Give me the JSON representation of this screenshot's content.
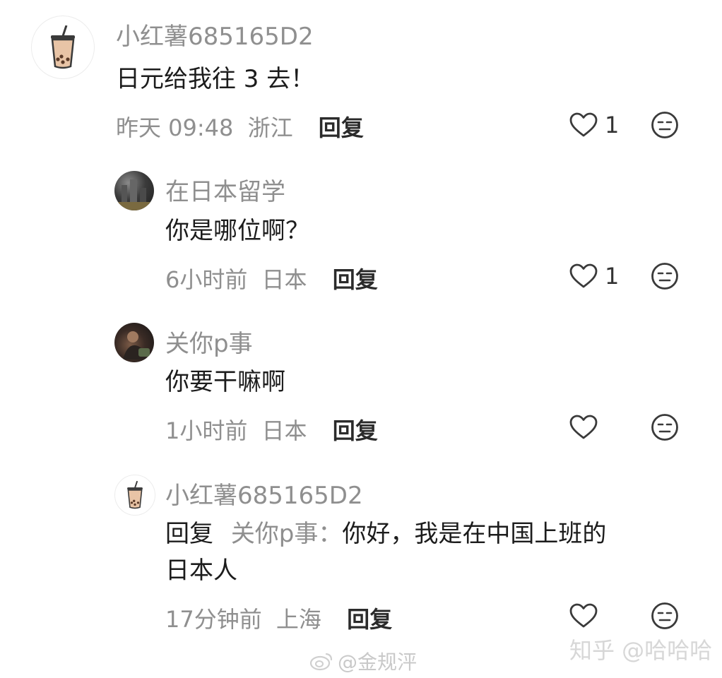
{
  "comments": [
    {
      "username": "小红薯685165D2",
      "text": "日元给我往 3 去！",
      "time": "昨天 09:48",
      "location": "浙江",
      "reply_label": "回复",
      "likes": "1",
      "avatar": "bubble-tea-icon"
    },
    {
      "username": "在日本留学",
      "text": "你是哪位啊？",
      "time": "6小时前",
      "location": "日本",
      "reply_label": "回复",
      "likes": "1",
      "avatar": "night-city-photo"
    },
    {
      "username": "关你p事",
      "text": "你要干嘛啊",
      "time": "1小时前",
      "location": "日本",
      "reply_label": "回复",
      "likes": "",
      "avatar": "person-photo"
    },
    {
      "username": "小红薯685165D2",
      "reply_prefix": "回复",
      "reply_to": "关你p事：",
      "text_line1": "你好，我是在中国上班的",
      "text_line2": "日本人",
      "time": "17分钟前",
      "location": "上海",
      "reply_label": "回复",
      "likes": "",
      "avatar": "bubble-tea-icon"
    }
  ],
  "watermarks": {
    "weibo": "@金规泙",
    "zhihu": "知乎 @哈哈哈"
  },
  "icons": {
    "like": "heart-outline-icon",
    "dislike": "meh-face-icon"
  }
}
